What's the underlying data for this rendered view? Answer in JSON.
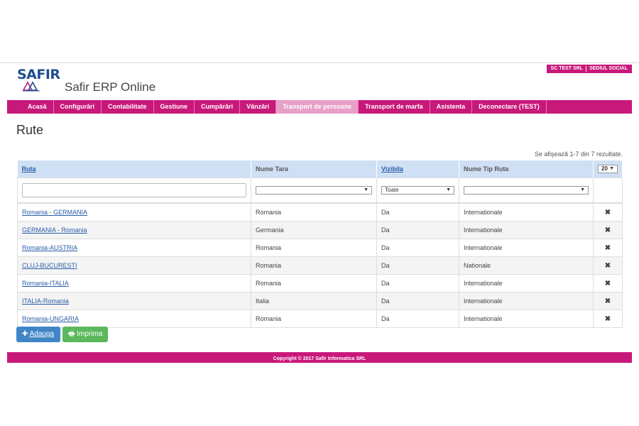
{
  "company": {
    "name": "SC TEST SRL",
    "office": "SEDIUL SOCIAL"
  },
  "logo": {
    "text": "SAFIR"
  },
  "app_title": "Safir ERP Online",
  "nav": {
    "items": [
      {
        "label": "Acasă",
        "active": false
      },
      {
        "label": "Configurări",
        "active": false
      },
      {
        "label": "Contabilitate",
        "active": false
      },
      {
        "label": "Gestiune",
        "active": false
      },
      {
        "label": "Cumpărări",
        "active": false
      },
      {
        "label": "Vânzări",
        "active": false
      },
      {
        "label": "Transport de persoane",
        "active": true
      },
      {
        "label": "Transport de marfa",
        "active": false
      },
      {
        "label": "Asistenta",
        "active": false
      },
      {
        "label": "Deconectare (TEST)",
        "active": false
      }
    ]
  },
  "page_title": "Rute",
  "results_text": "Se afişează 1-7 din 7 rezultate.",
  "table": {
    "headers": {
      "ruta": "Ruta",
      "tara": "Nume Tara",
      "vizibila": "Vizibila",
      "tip": "Nume Tip Ruta",
      "page_size": "20"
    },
    "filters": {
      "ruta_value": "",
      "tara_value": "",
      "vizibila_value": "Toate",
      "tip_value": ""
    },
    "rows": [
      {
        "ruta": "Romania - GERMANIA",
        "tara": "Romania",
        "vizibila": "Da",
        "tip": "Internationale"
      },
      {
        "ruta": "GERMANIA - Romania",
        "tara": "Germania",
        "vizibila": "Da",
        "tip": "Internationale"
      },
      {
        "ruta": "Romania-AUSTRIA",
        "tara": "Romania",
        "vizibila": "Da",
        "tip": "Internationale"
      },
      {
        "ruta": "CLUJ-BUCURESTI",
        "tara": "Romania",
        "vizibila": "Da",
        "tip": "Nationale"
      },
      {
        "ruta": "Romania-ITALIA",
        "tara": "Romania",
        "vizibila": "Da",
        "tip": "Internationale"
      },
      {
        "ruta": "ITALIA-Romania",
        "tara": "Italia",
        "vizibila": "Da",
        "tip": "Internationale"
      },
      {
        "ruta": "Romania-UNGARIA",
        "tara": "Romania",
        "vizibila": "Da",
        "tip": "Internationale"
      }
    ]
  },
  "buttons": {
    "add": "Adauga",
    "print": "Imprima"
  },
  "footer": "Copyright © 2017 Safir Informatica SRL",
  "colors": {
    "brand": "#c8187a",
    "nav_active": "#e7a0c7",
    "header_bg": "#cfe0f5",
    "link": "#2a5da8",
    "add_btn": "#3f86c7",
    "print_btn": "#5cb85c"
  },
  "icons": {
    "delete": "close-icon",
    "add": "plus-icon",
    "print": "printer-icon"
  }
}
